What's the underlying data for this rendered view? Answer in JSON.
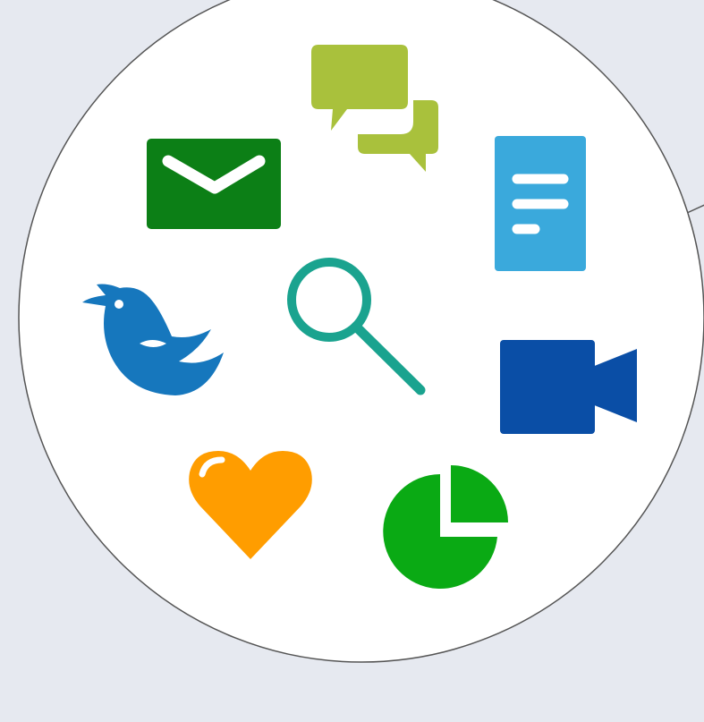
{
  "colors": {
    "background": "#e6e9f0",
    "circle_fill": "#ffffff",
    "circle_stroke": "#555555",
    "chat": "#a9c13c",
    "mail": "#0c7f16",
    "document": "#3aa9dc",
    "bird": "#1677bd",
    "search": "#1aa38f",
    "video": "#0a4ea6",
    "heart": "#ff9d00",
    "pie": "#0aaa14"
  },
  "icons": [
    {
      "name": "chat-bubbles-icon",
      "color_key": "chat"
    },
    {
      "name": "mail-icon",
      "color_key": "mail"
    },
    {
      "name": "document-icon",
      "color_key": "document"
    },
    {
      "name": "bird-icon",
      "color_key": "bird"
    },
    {
      "name": "search-icon",
      "color_key": "search"
    },
    {
      "name": "video-camera-icon",
      "color_key": "video"
    },
    {
      "name": "heart-icon",
      "color_key": "heart"
    },
    {
      "name": "pie-chart-icon",
      "color_key": "pie"
    }
  ]
}
